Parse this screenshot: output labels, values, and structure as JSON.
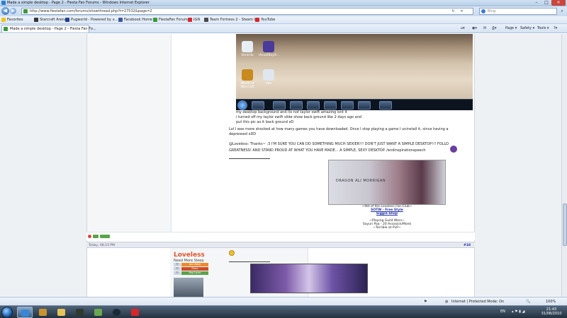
{
  "window": {
    "title": "Made a simple desktop - Page 2 - Fiesta Fan Forums - Windows Internet Explorer"
  },
  "address": {
    "url": "http://www.fiestafan.com/forums/showthread.php?t=27532&page=2",
    "search_placeholder": "Bing"
  },
  "favorites_bar": {
    "favorites_label": "Favorites",
    "items": [
      {
        "label": "Starcraft Arena",
        "color": "#333333"
      },
      {
        "label": "Pugworld - Powered by v...",
        "color": "#1f3f8a"
      },
      {
        "label": "Facebook Home",
        "color": "#3b5998"
      },
      {
        "label": "FiestaFan Forums",
        "color": "#3b9a3b"
      },
      {
        "label": "IGN",
        "color": "#d8262f"
      },
      {
        "label": "Team Fortress 2 - Steam U...",
        "color": "#4a4a4a"
      },
      {
        "label": "YouTube",
        "color": "#d8262f"
      }
    ]
  },
  "tab": {
    "label": "Made a simple desktop - Page 2 - Fiesta Fan Fo..."
  },
  "command_bar": {
    "page_label": "Page ▾",
    "safety_label": "Safety ▾",
    "tools_label": "Tools ▾"
  },
  "post1": {
    "desktop_icons": [
      {
        "label": "Ventrilo",
        "color": "#e8eef6"
      },
      {
        "label": "VisualBoyA...",
        "color": "#4a3a9a"
      },
      {
        "label": "World of Warcraft",
        "color": "#c98a1e"
      },
      {
        "label": "vba",
        "color": "#dfe6ee"
      }
    ],
    "lines": [
      "my desktop background and its not taylor swift amazing isnt it",
      "i turned off my taylor swift slide show back ground like 2 days ago and",
      "put this pic as it back ground xD"
    ],
    "reply1": "Lol I was more shocked at how many games you have downloaded. Once I stop playing a game I uninstall it, since having a",
    "reply1_b": "depressed xDD",
    "reply2": "@Loveless: Thanks~ :3 I'M SURE YOU CAN DO SOMETHING MUCH SEXIER!!! DON'T JUST WANT A SIMPLE DESKTOP!!! FOLLO",
    "reply2_b": "GREATNESS! AND STAND PROUD AT WHAT YOU HAVE MADE... A SIMPLE, SEXY DESKTOP. /endinspirationspeech",
    "banner_text": "DRAGON ALI MORRIGAN",
    "sig_lines": [
      "~Pet of the Loveless Fan-Club~",
      "SOTW - Free Style",
      "Siggie Shop",
      "~Playing Guild Wars~",
      "Sayuri Paa - 20 Assassin/Monk",
      "~Terrible at PvP~"
    ]
  },
  "post2": {
    "date": "Today, 08:23 PM",
    "post_number": "#18",
    "username": "Loveless",
    "user_title": "Need More Sleep",
    "user_rows": [
      {
        "key": "??",
        "value": "Join Date",
        "color": "#e98d2c"
      },
      {
        "key": "??",
        "value": "Posts",
        "color": "#d14b28"
      },
      {
        "key": "??",
        "value": "Rep Level",
        "color": "#5aa34a"
      }
    ]
  },
  "status": {
    "zone": "Internet | Protected Mode: On",
    "zoom": "100%"
  },
  "taskbar": {
    "language": "EN",
    "time": "21:43",
    "date": "31/08/2010"
  }
}
